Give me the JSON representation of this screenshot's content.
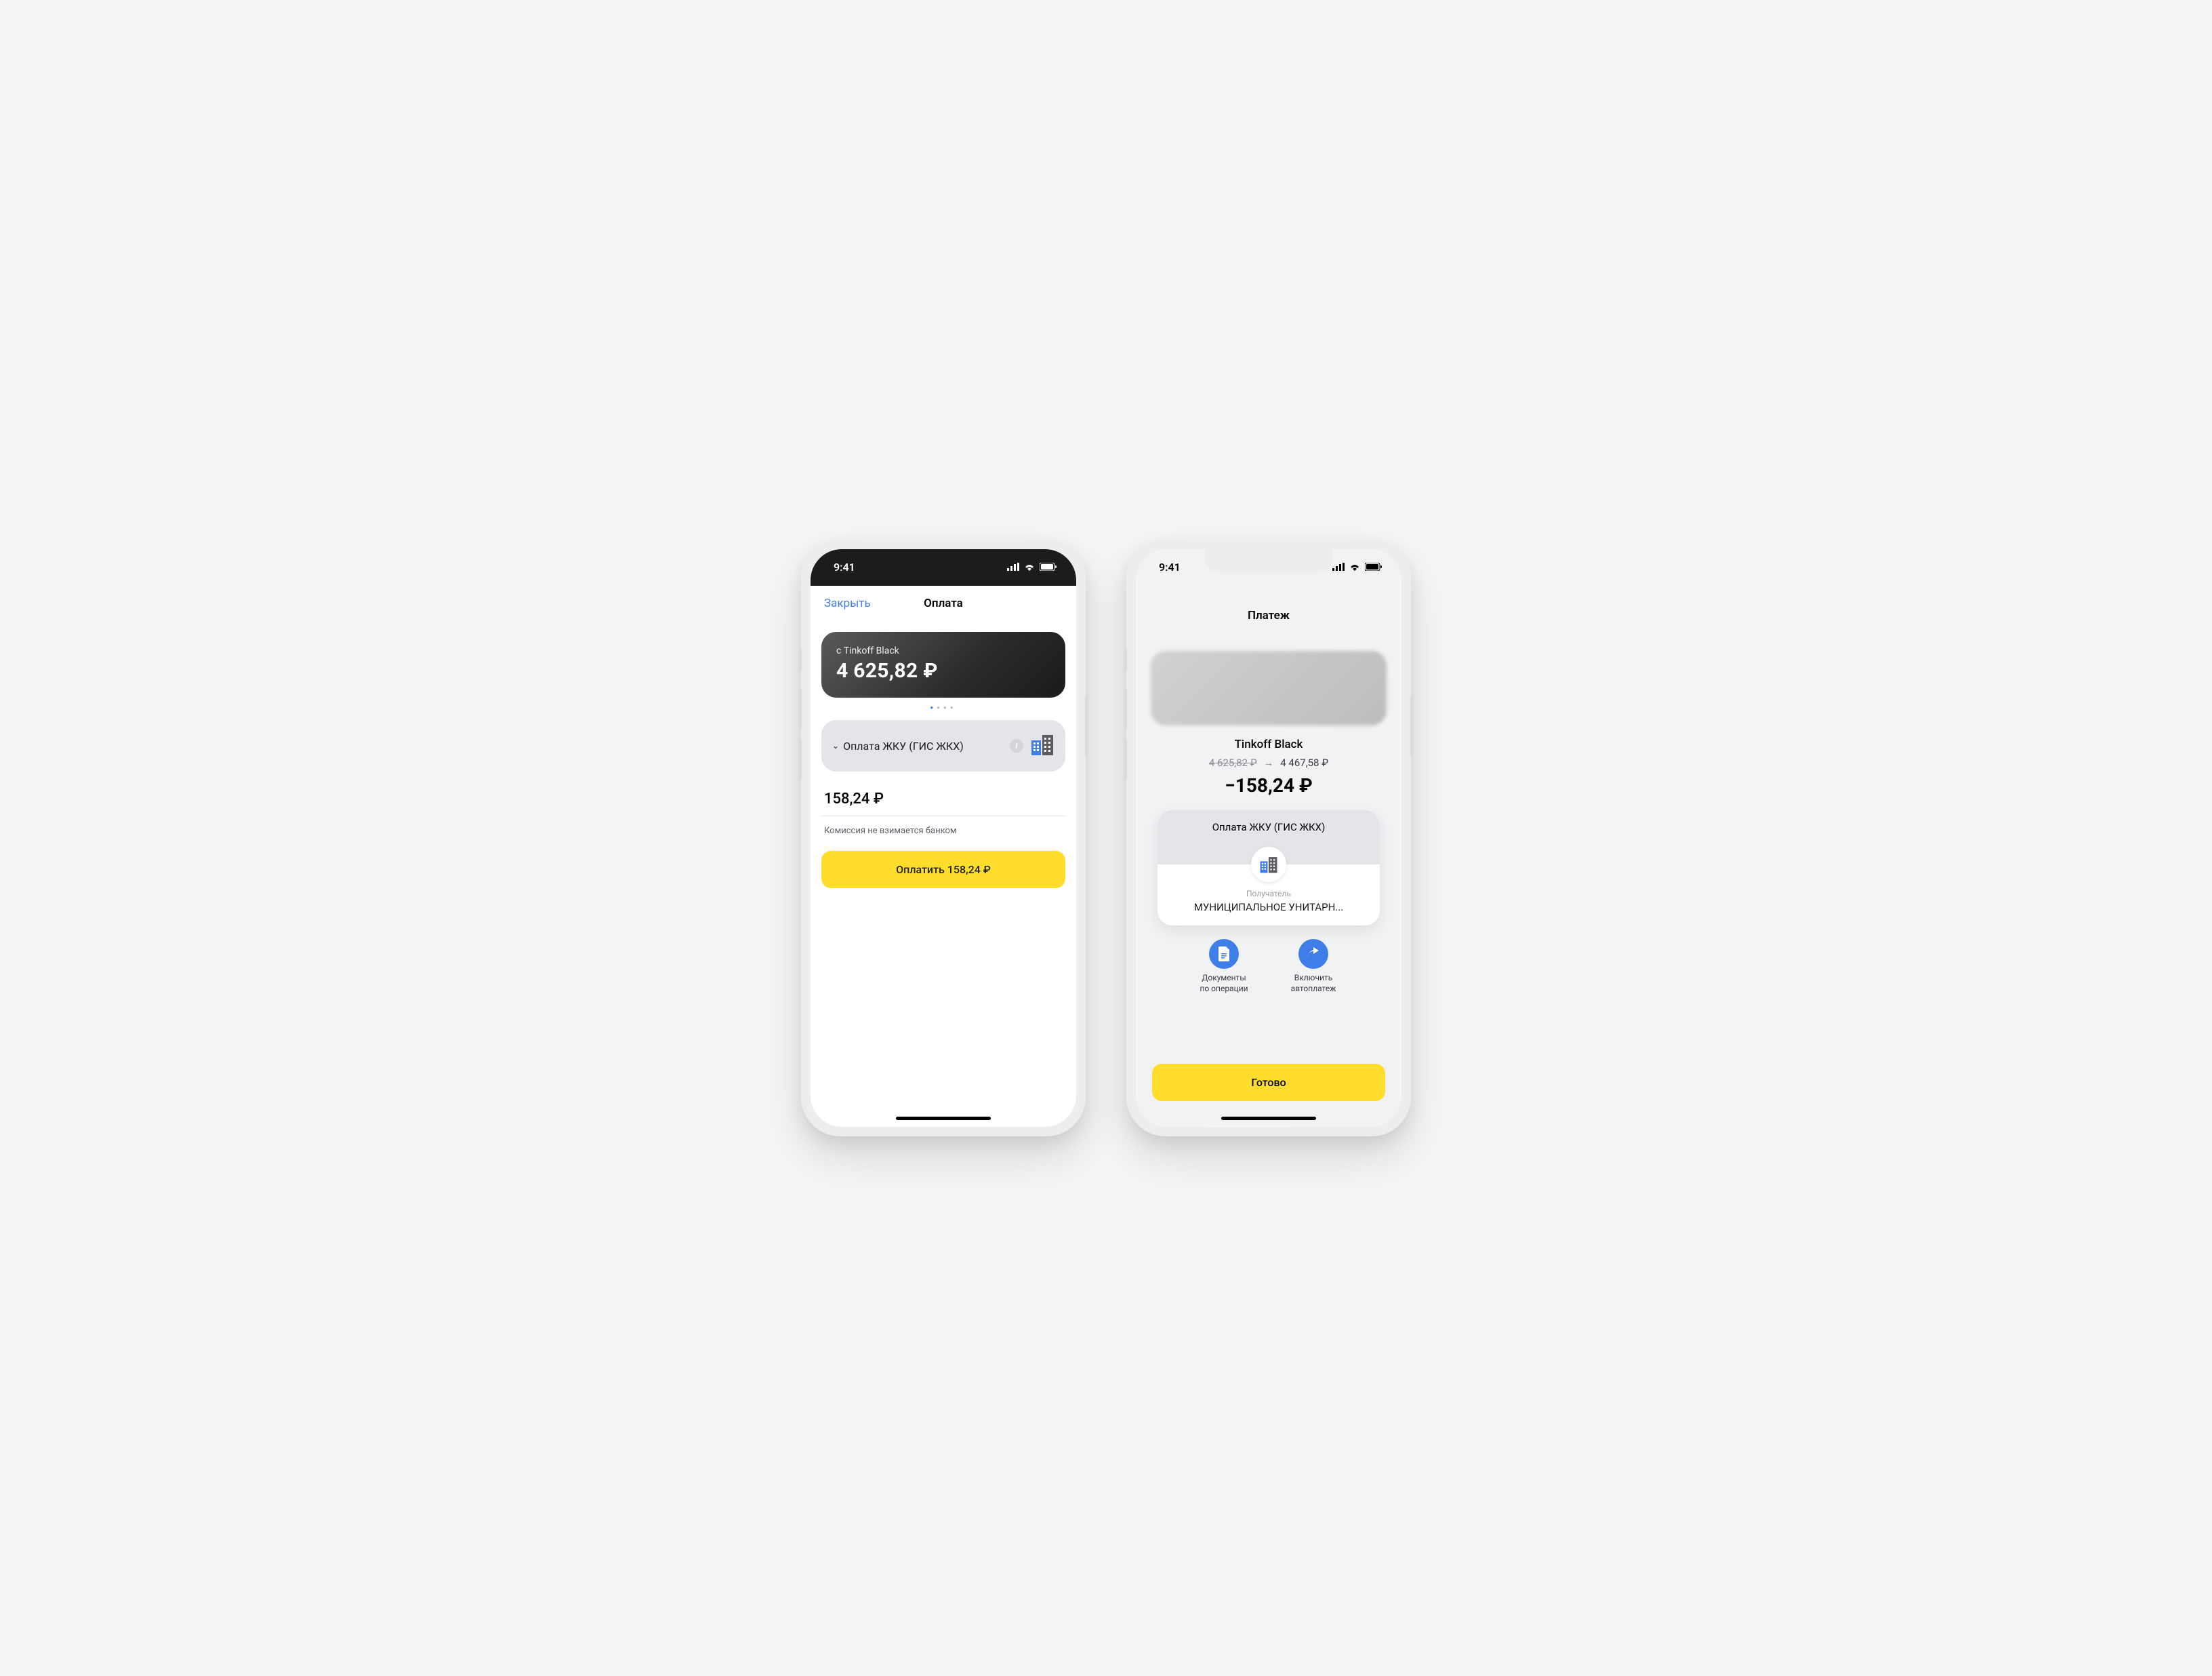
{
  "status": {
    "time": "9:41"
  },
  "screen1": {
    "nav": {
      "close": "Закрыть",
      "title": "Оплата"
    },
    "card": {
      "label": "с Tinkoff Black",
      "balance": "4 625,82 ₽"
    },
    "provider": {
      "name": "Оплата ЖКУ (ГИС ЖКХ)"
    },
    "amount": "158,24 ₽",
    "fee_note": "Комиссия не взимается банком",
    "pay_button": "Оплатить 158,24 ₽"
  },
  "screen2": {
    "title": "Платеж",
    "account_name": "Tinkoff Black",
    "balance_before": "4 625,82 ₽",
    "balance_after": "4 467,58 ₽",
    "delta": "−158,24 ₽",
    "receipt": {
      "category": "Оплата ЖКУ (ГИС ЖКХ)",
      "recipient_label": "Получатель",
      "recipient_name": "МУНИЦИПАЛЬНОЕ УНИТАРН..."
    },
    "actions": {
      "docs": "Документы по операции",
      "autopay": "Включить автоплатеж"
    },
    "done_button": "Готово"
  }
}
